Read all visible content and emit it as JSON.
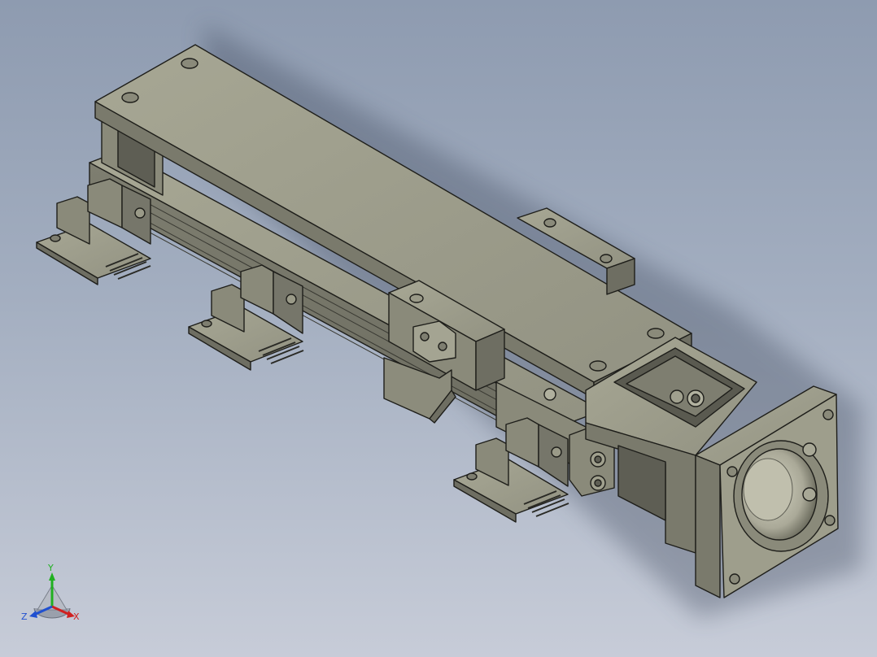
{
  "viewport": {
    "background_top": "#8e9bb0",
    "background_bottom": "#c7ccd8",
    "model_face_color": "#9a9a88",
    "model_edge_color": "#1e1e1a"
  },
  "triad": {
    "x_label": "X",
    "y_label": "Y",
    "z_label": "Z",
    "x_color": "#d02020",
    "y_color": "#20b020",
    "z_color": "#2050d0"
  }
}
